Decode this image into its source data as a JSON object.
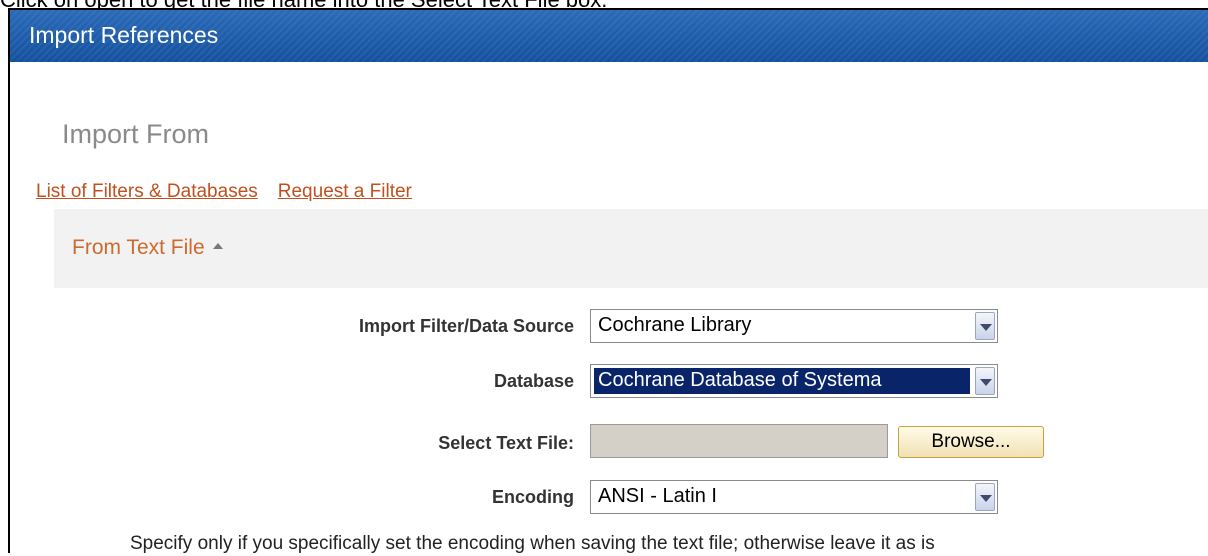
{
  "caption": "Click on open to get the file name into the Select Text File box.",
  "window": {
    "title": "Import References"
  },
  "heading": "Import From",
  "links": {
    "filters_databases": "List of Filters & Databases",
    "request_filter": "Request a Filter"
  },
  "section": {
    "title": "From Text File",
    "icon": "caret-up-icon"
  },
  "form": {
    "import_filter": {
      "label": "Import Filter/Data Source",
      "value": "Cochrane Library"
    },
    "database": {
      "label": "Database",
      "value": "Cochrane Database of Systema"
    },
    "text_file": {
      "label": "Select Text File:",
      "value": "",
      "browse_label": "Browse..."
    },
    "encoding": {
      "label": "Encoding",
      "value": "ANSI - Latin I"
    },
    "note": "Specify only if you specifically set the encoding when saving the text file; otherwise leave it as is"
  },
  "colors": {
    "titlebar": "#1a5aa8",
    "link": "#c0501e",
    "section_title": "#cd6a2e",
    "selection": "#0a246a"
  }
}
